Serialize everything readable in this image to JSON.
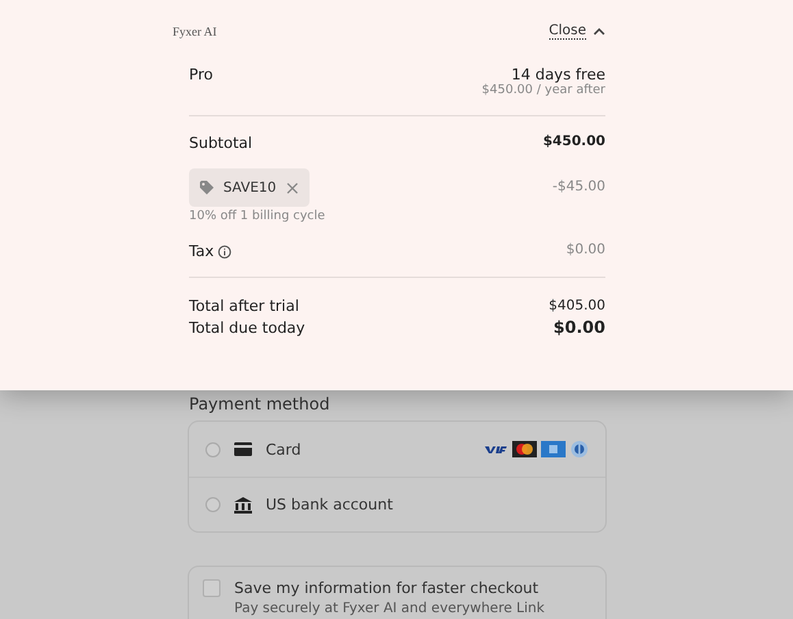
{
  "summary": {
    "brand": "Fyxer AI",
    "close_label": "Close",
    "plan": {
      "name": "Pro",
      "trial": "14 days free",
      "after": "$450.00 / year after"
    },
    "subtotal": {
      "label": "Subtotal",
      "value": "$450.00"
    },
    "discount": {
      "code": "SAVE10",
      "description": "10% off 1 billing cycle",
      "amount": "-$45.00"
    },
    "tax": {
      "label": "Tax",
      "value": "$0.00"
    },
    "totals": [
      {
        "label": "Total after trial",
        "value": "$405.00",
        "emphasis": false
      },
      {
        "label": "Total due today",
        "value": "$0.00",
        "emphasis": true
      }
    ]
  },
  "payment": {
    "heading": "Payment method",
    "methods": [
      {
        "label": "Card",
        "kind": "card",
        "selected": false
      },
      {
        "label": "US bank account",
        "kind": "bank",
        "selected": false
      }
    ],
    "save": {
      "checked": false,
      "label": "Save my information for faster checkout",
      "description": "Pay securely at Fyxer AI and everywhere Link"
    }
  }
}
